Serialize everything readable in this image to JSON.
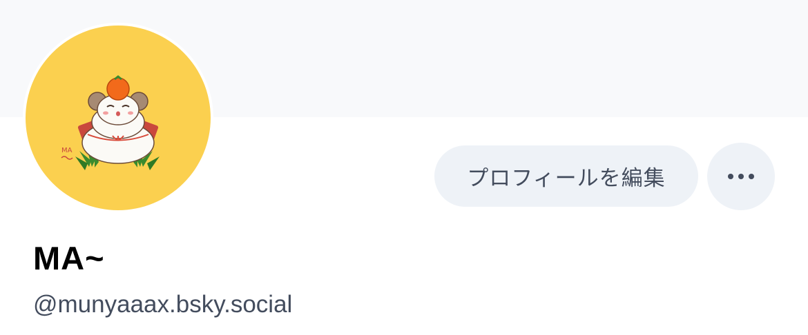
{
  "profile": {
    "display_name": "MA~",
    "handle": "@munyaaax.bsky.social",
    "avatar_signature": "MA~"
  },
  "actions": {
    "edit_profile_label": "プロフィールを編集",
    "more_icon": "ellipsis-icon"
  },
  "colors": {
    "banner": "#f8f9fb",
    "button_bg": "#eef2f7",
    "button_text": "#434c5d",
    "avatar_bg": "#fbd04f",
    "handle_text": "#434c5d"
  }
}
